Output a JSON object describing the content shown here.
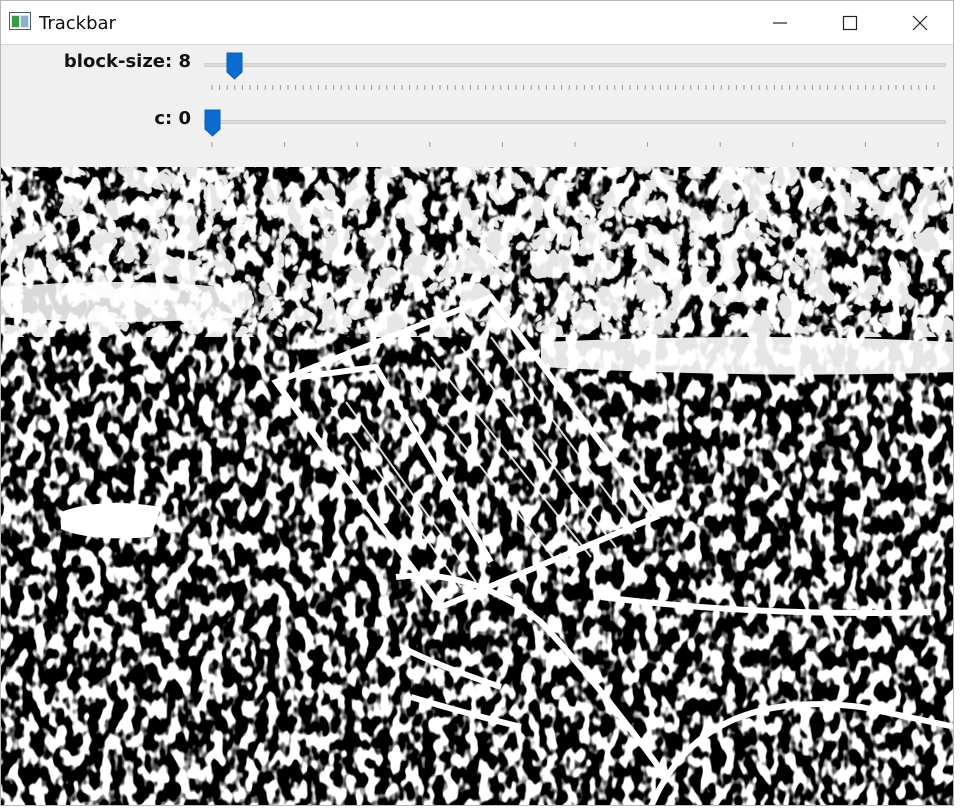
{
  "window": {
    "title": "Trackbar",
    "icon": "window-app-icon",
    "controls": [
      "minimize-icon",
      "maximize-icon",
      "close-icon"
    ]
  },
  "trackbars": [
    {
      "label": "block-size: 8",
      "name": "block-size",
      "value": 8,
      "max": 255,
      "tick_style": "dense"
    },
    {
      "label": "c: 0",
      "name": "c",
      "value": 0,
      "max": 10,
      "tick_style": "sparse"
    }
  ],
  "image": {
    "description": "thresholded black-and-white image",
    "colors": {
      "foreground": "#ffffff",
      "background": "#000000"
    }
  },
  "colors": {
    "thumb": "#0a6bd1",
    "panel": "#f0f0f0",
    "titlebar": "#ffffff"
  }
}
